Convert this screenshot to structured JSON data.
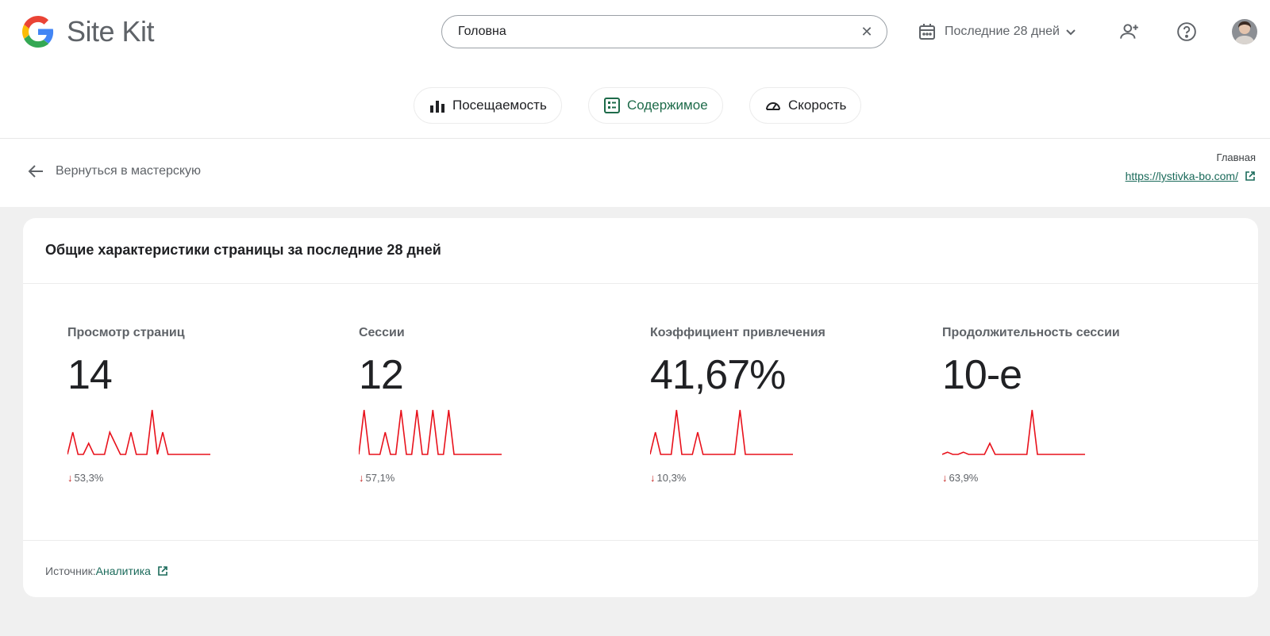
{
  "app": {
    "name": "Site Kit"
  },
  "search": {
    "value": "Головна"
  },
  "header": {
    "date_range_label": "Последние 28 дней"
  },
  "tabs": [
    {
      "label": "Посещаемость"
    },
    {
      "label": "Содержимое",
      "active": true
    },
    {
      "label": "Скорость"
    }
  ],
  "subbar": {
    "back_label": "Вернуться в мастерскую",
    "page_label": "Главная",
    "page_url": "https://lystivka-bo.com/"
  },
  "card": {
    "title": "Общие характеристики страницы за последние 28 дней",
    "metrics": [
      {
        "label": "Просмотр страниц",
        "value": "14",
        "change": "53,3%",
        "trend": "down",
        "sparkline": [
          0,
          1,
          0,
          0,
          0.5,
          0,
          0,
          0,
          1,
          0.5,
          0,
          0,
          1,
          0,
          0,
          0,
          2,
          0,
          1,
          0,
          0,
          0,
          0,
          0,
          0,
          0,
          0,
          0
        ]
      },
      {
        "label": "Сессии",
        "value": "12",
        "change": "57,1%",
        "trend": "down",
        "sparkline": [
          0,
          1,
          0,
          0,
          0,
          0.5,
          0,
          0,
          1,
          0,
          0,
          1,
          0,
          0,
          1,
          0,
          0,
          1,
          0,
          0,
          0,
          0,
          0,
          0,
          0,
          0,
          0,
          0
        ]
      },
      {
        "label": "Коэффициент привлечения",
        "value": "41,67%",
        "change": "10,3%",
        "trend": "down",
        "sparkline": [
          0,
          1,
          0,
          0,
          0,
          2,
          0,
          0,
          0,
          1,
          0,
          0,
          0,
          0,
          0,
          0,
          0,
          2,
          0,
          0,
          0,
          0,
          0,
          0,
          0,
          0,
          0,
          0
        ]
      },
      {
        "label": "Продолжительность сессии",
        "value": "10-е",
        "change": "63,9%",
        "trend": "down",
        "sparkline": [
          0,
          0.1,
          0,
          0,
          0.1,
          0,
          0,
          0,
          0,
          0.5,
          0,
          0,
          0,
          0,
          0,
          0,
          0,
          2,
          0,
          0,
          0,
          0,
          0,
          0,
          0,
          0,
          0,
          0
        ]
      }
    ],
    "source_label": "Источник:",
    "source_link": "Аналитика"
  },
  "colors": {
    "sparkline": "#e8111b",
    "accent": "#1e6b4a",
    "link": "#1a6a5a",
    "trend_down": "#c5221f"
  },
  "icons": [
    "google-g-icon",
    "clear-icon",
    "calendar-icon",
    "chevron-down-icon",
    "add-user-icon",
    "help-icon",
    "bar-chart-icon",
    "content-icon",
    "speedometer-icon",
    "arrow-left-icon",
    "external-link-icon",
    "arrow-down-icon"
  ]
}
